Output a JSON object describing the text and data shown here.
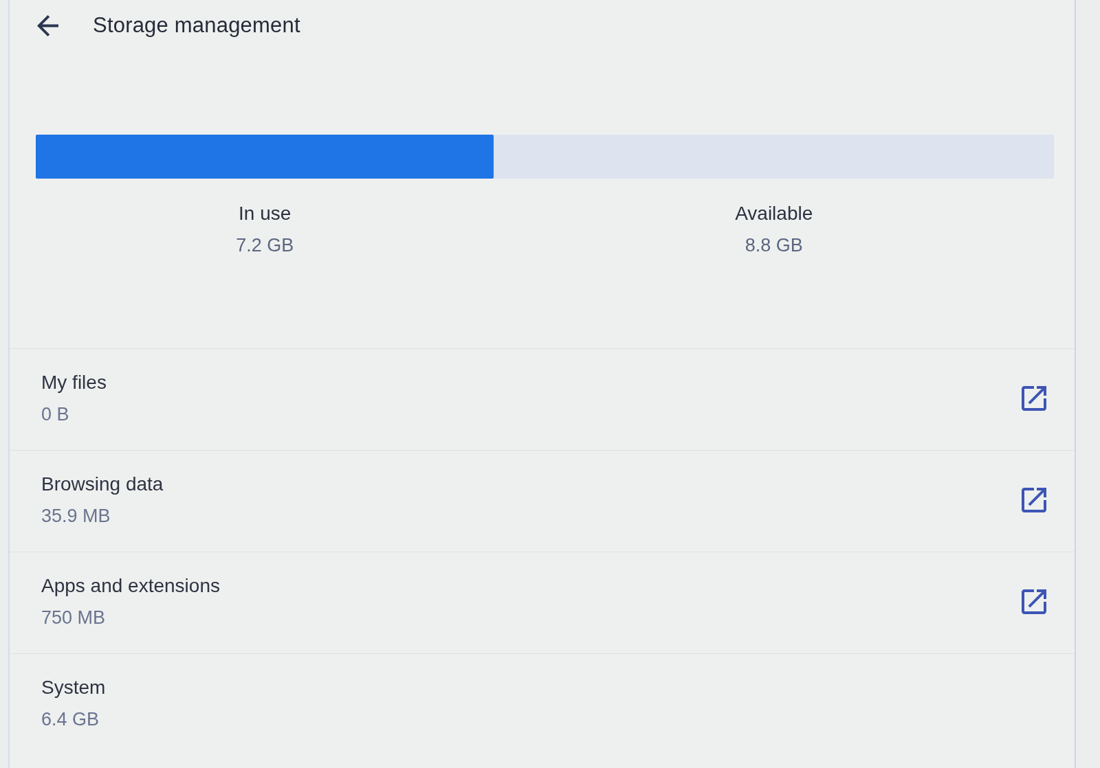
{
  "header": {
    "title": "Storage management"
  },
  "usage_bar": {
    "level": 0.45
  },
  "summary": [
    {
      "label": "In use",
      "value": "7.2 GB"
    },
    {
      "label": "Available",
      "value": "8.8 GB"
    }
  ],
  "items": [
    {
      "kind": "link",
      "label": "My files",
      "value": "0 B"
    },
    {
      "kind": "link",
      "label": "Browsing data",
      "value": "35.9 MB"
    },
    {
      "kind": "link",
      "label": "Apps and extensions",
      "value": "750 MB"
    },
    {
      "kind": "info",
      "label": "System",
      "value": "6.4 GB"
    }
  ]
}
